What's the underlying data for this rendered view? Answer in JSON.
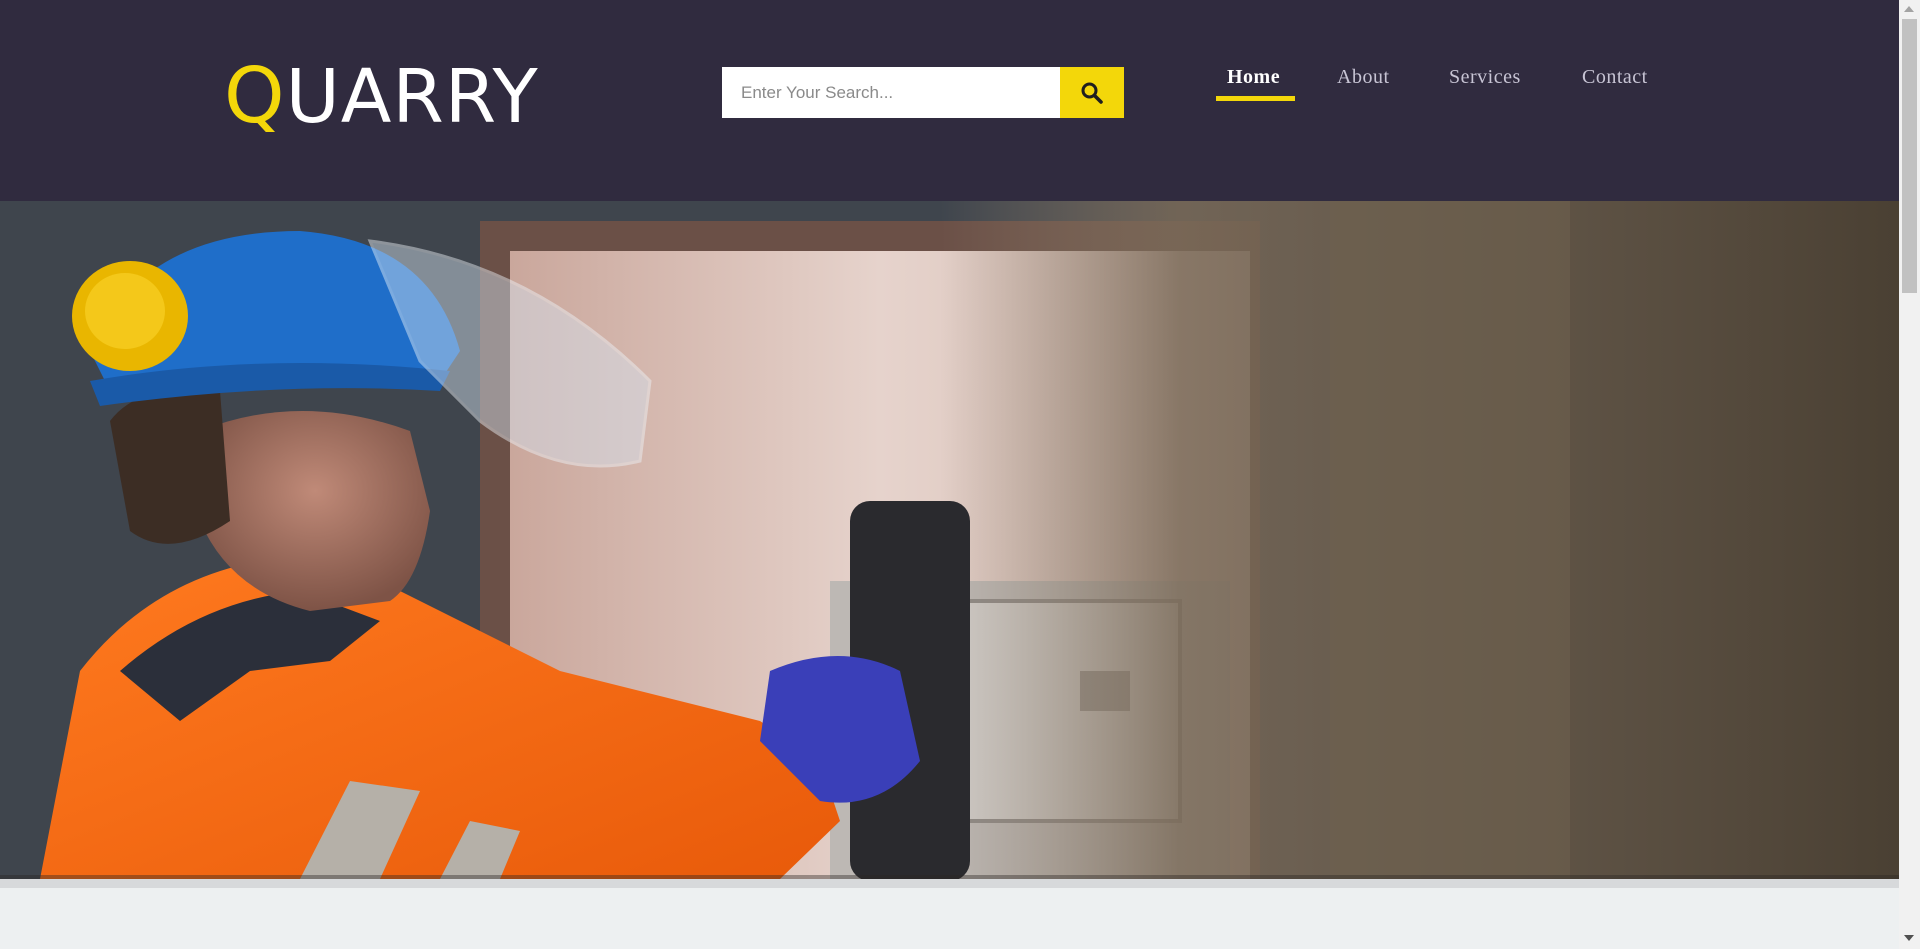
{
  "brand": {
    "logo_first_letter": "Q",
    "logo_rest": "UARRY"
  },
  "search": {
    "placeholder": "Enter Your Search...",
    "value": "",
    "button_icon": "search-icon"
  },
  "nav": {
    "items": [
      {
        "label": "Home",
        "active": true
      },
      {
        "label": "About",
        "active": false
      },
      {
        "label": "Services",
        "active": false
      },
      {
        "label": "Contact",
        "active": false
      }
    ]
  },
  "hero": {
    "image": "worker-in-safety-gear-with-thermal-camera"
  },
  "colors": {
    "header_bg": "#302b3f",
    "accent": "#f3d70a",
    "nav_text": "#c7c4d4",
    "nav_active_text": "#ffffff",
    "page_bg": "#edf0f1"
  }
}
